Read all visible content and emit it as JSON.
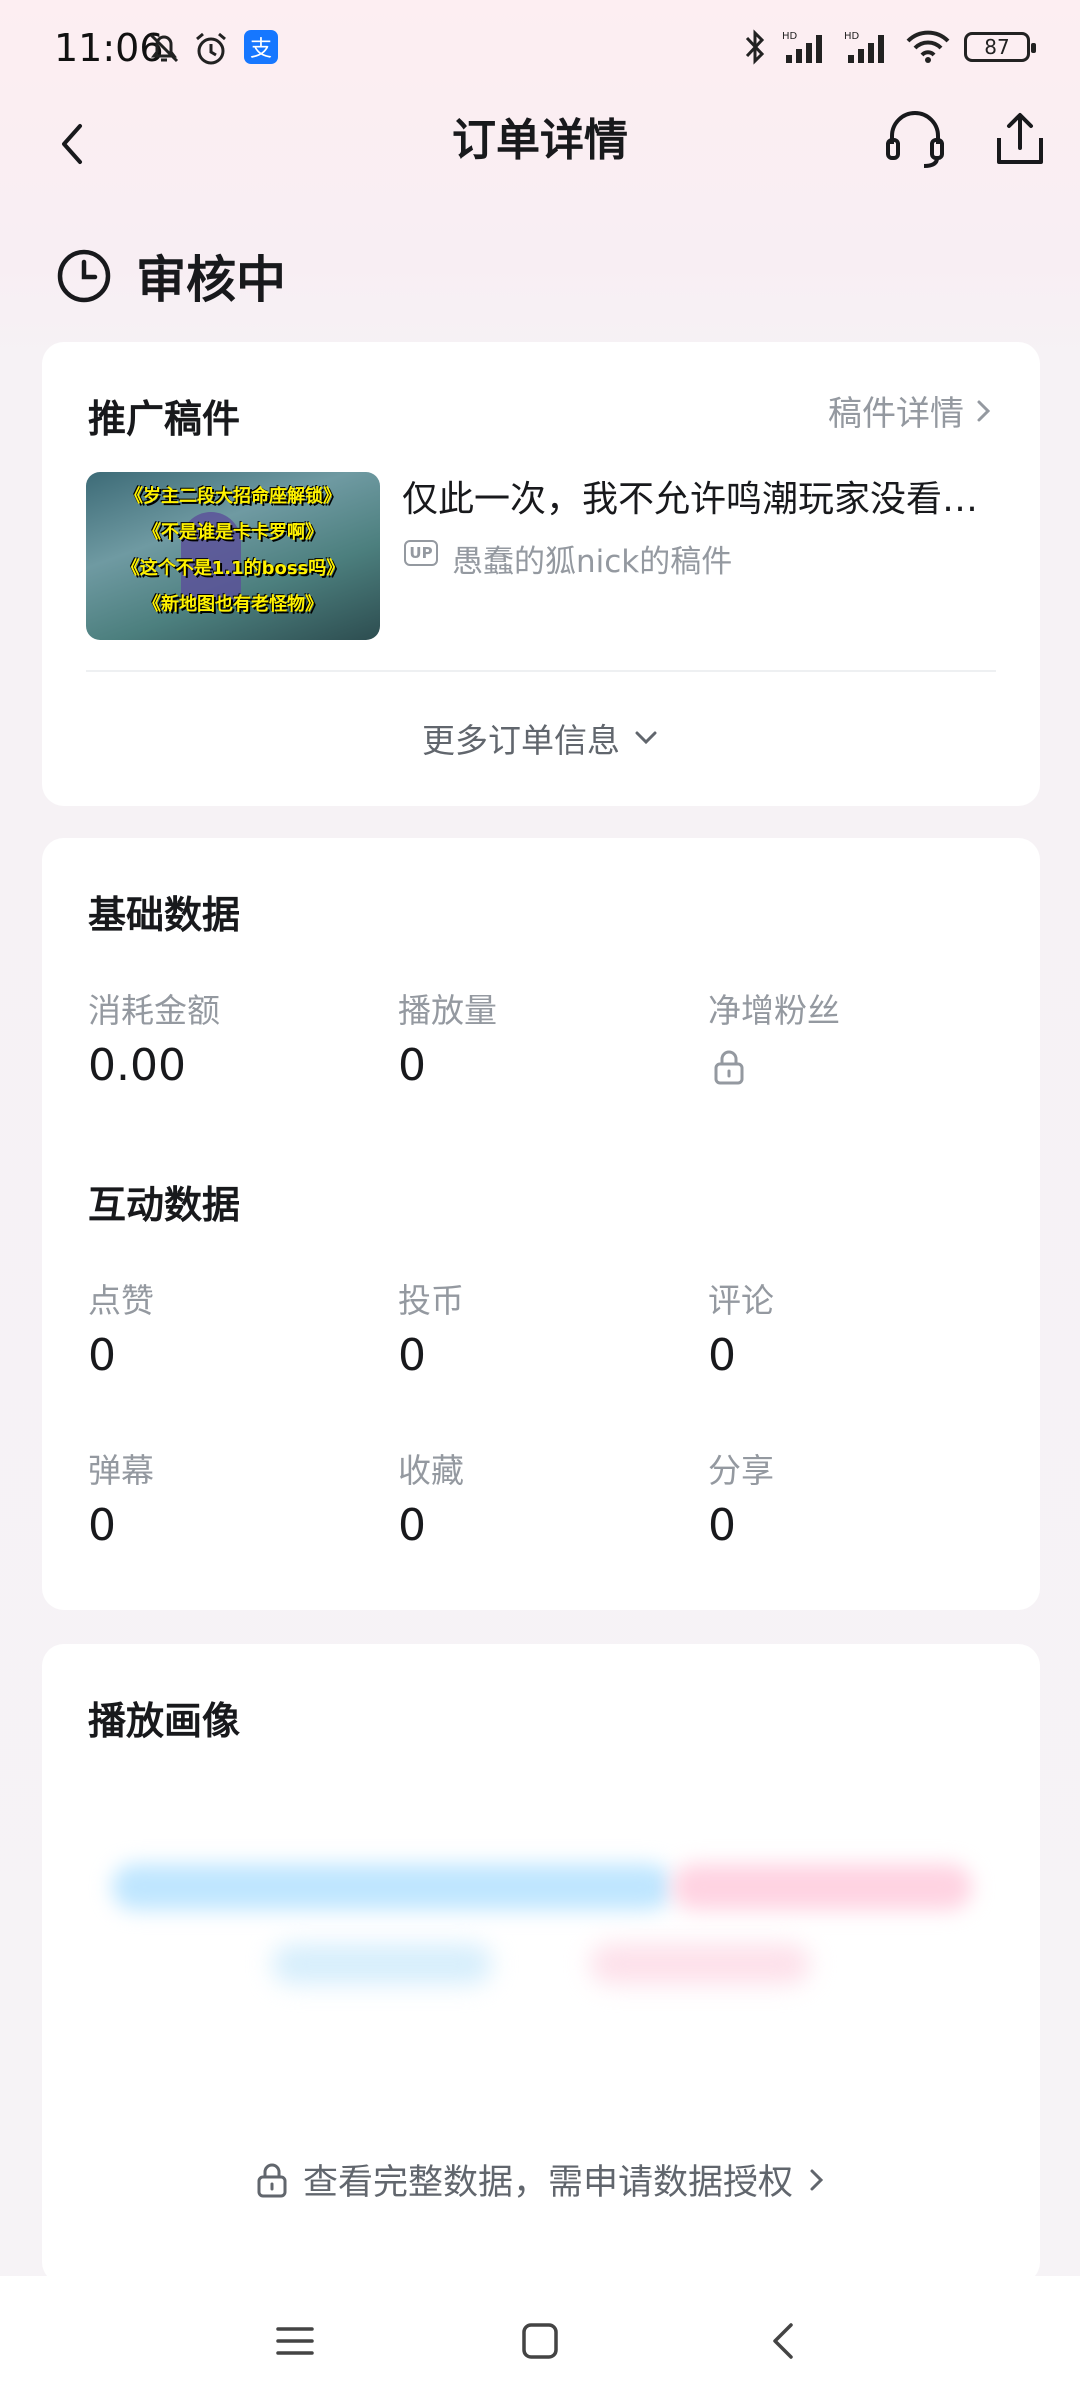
{
  "status_bar": {
    "time": "11:06",
    "battery": "87"
  },
  "nav": {
    "title": "订单详情"
  },
  "order_status": {
    "text": "审核中"
  },
  "promo_card": {
    "title": "推广稿件",
    "detail_link": "稿件详情",
    "thumbnail_lines": [
      "《岁主二段大招命座解锁》",
      "《不是谁是卡卡罗啊》",
      "《这个不是1.1的boss吗》",
      "《新地图也有老怪物》"
    ],
    "video_title": "仅此一次，我不允许鸣潮玩家没看…",
    "up_badge": "UP",
    "up_name": "愚蠢的狐nick的稿件",
    "more_info": "更多订单信息"
  },
  "basic_data": {
    "title": "基础数据",
    "metrics": [
      {
        "label": "消耗金额",
        "value": "0.00"
      },
      {
        "label": "播放量",
        "value": "0"
      },
      {
        "label": "净增粉丝",
        "locked": true
      }
    ]
  },
  "interaction_data": {
    "title": "互动数据",
    "metrics": [
      {
        "label": "点赞",
        "value": "0"
      },
      {
        "label": "投币",
        "value": "0"
      },
      {
        "label": "评论",
        "value": "0"
      },
      {
        "label": "弹幕",
        "value": "0"
      },
      {
        "label": "收藏",
        "value": "0"
      },
      {
        "label": "分享",
        "value": "0"
      }
    ]
  },
  "audience": {
    "title": "播放画像",
    "auth_link": "查看完整数据，需申请数据授权"
  },
  "colors": {
    "accent_blue": "#bfe6ff",
    "accent_pink": "#ffd3e2",
    "muted": "#9499a0"
  },
  "icons": [
    "bell-off-icon",
    "alarm-icon",
    "alipay-icon",
    "bluetooth-icon",
    "signal-icon",
    "wifi-icon",
    "battery-icon",
    "back-icon",
    "headset-icon",
    "share-icon",
    "clock-icon",
    "chevron-right-icon",
    "chevron-down-icon",
    "lock-icon",
    "menu-icon",
    "home-icon"
  ]
}
